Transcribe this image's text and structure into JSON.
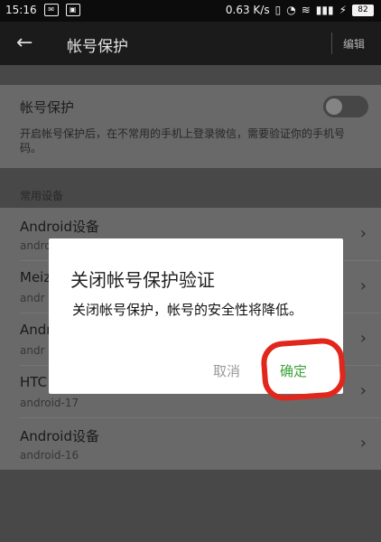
{
  "status": {
    "time": "15:16",
    "network": "0.63 K/s",
    "battery": "82"
  },
  "header": {
    "back_icon": "back-arrow-icon",
    "title": "帐号保护",
    "edit": "编辑"
  },
  "protection": {
    "label": "帐号保护",
    "description": "开启帐号保护后，在不常用的手机上登录微信，需要验证你的手机号码。",
    "toggle_state": "off"
  },
  "devices_section": {
    "title": "常用设备",
    "items": [
      {
        "name": "Android设备",
        "sub": "android"
      },
      {
        "name": "Meiz",
        "sub": "andr"
      },
      {
        "name": "Andr",
        "sub": "andr"
      },
      {
        "name": "HTC",
        "sub": "android-17"
      },
      {
        "name": "Android设备",
        "sub": "android-16"
      }
    ]
  },
  "dialog": {
    "title": "关闭帐号保护验证",
    "message": "关闭帐号保护，帐号的安全性将降低。",
    "cancel": "取消",
    "confirm": "确定"
  },
  "colors": {
    "confirm": "#3ca33a",
    "annotation": "#e1261c"
  }
}
